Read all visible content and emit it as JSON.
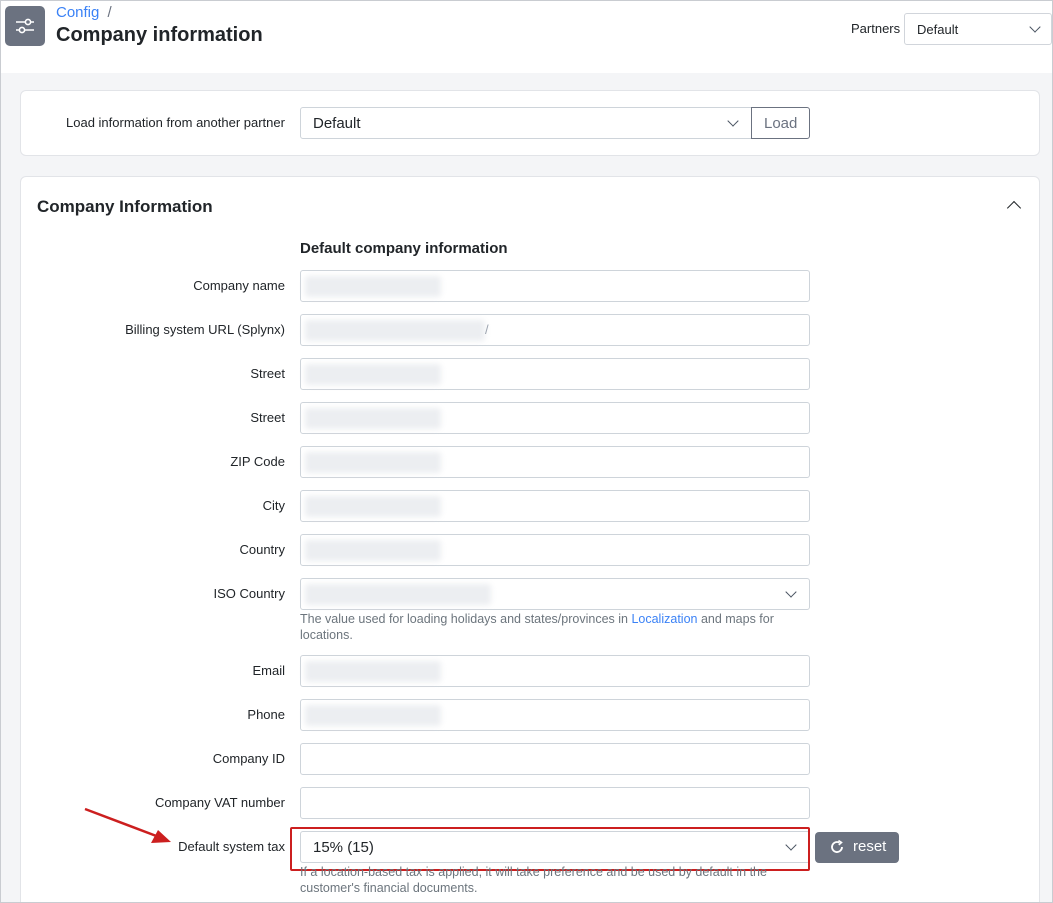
{
  "header": {
    "breadcrumb": "Config",
    "breadcrumb_sep": "/",
    "title": "Company information",
    "partners_label": "Partners",
    "partners_value": "Default"
  },
  "load": {
    "label": "Load information from another partner",
    "select_value": "Default",
    "button": "Load"
  },
  "company": {
    "section_title": "Company Information",
    "subsection_title": "Default company information",
    "fields": {
      "company_name": "Company name",
      "billing_url": "Billing system URL (Splynx)",
      "street1": "Street",
      "street2": "Street",
      "zip": "ZIP Code",
      "city": "City",
      "country": "Country",
      "iso_country": "ISO Country",
      "email": "Email",
      "phone": "Phone",
      "company_id": "Company ID",
      "vat": "Company VAT number",
      "tax": "Default system tax"
    },
    "billing_url_suffix": "/",
    "iso_help_before": "The value used for loading holidays and states/provinces in ",
    "iso_help_link": "Localization",
    "iso_help_after": " and maps for locations.",
    "tax_value": "15% (15)",
    "reset_button": "reset",
    "tax_help": "If a location-based tax is applied, it will take preference and be used by default in the customer's financial documents."
  },
  "colors": {
    "accent": "#3b82f6",
    "highlight": "#cc1f1f",
    "button_gray": "#6b7280"
  }
}
